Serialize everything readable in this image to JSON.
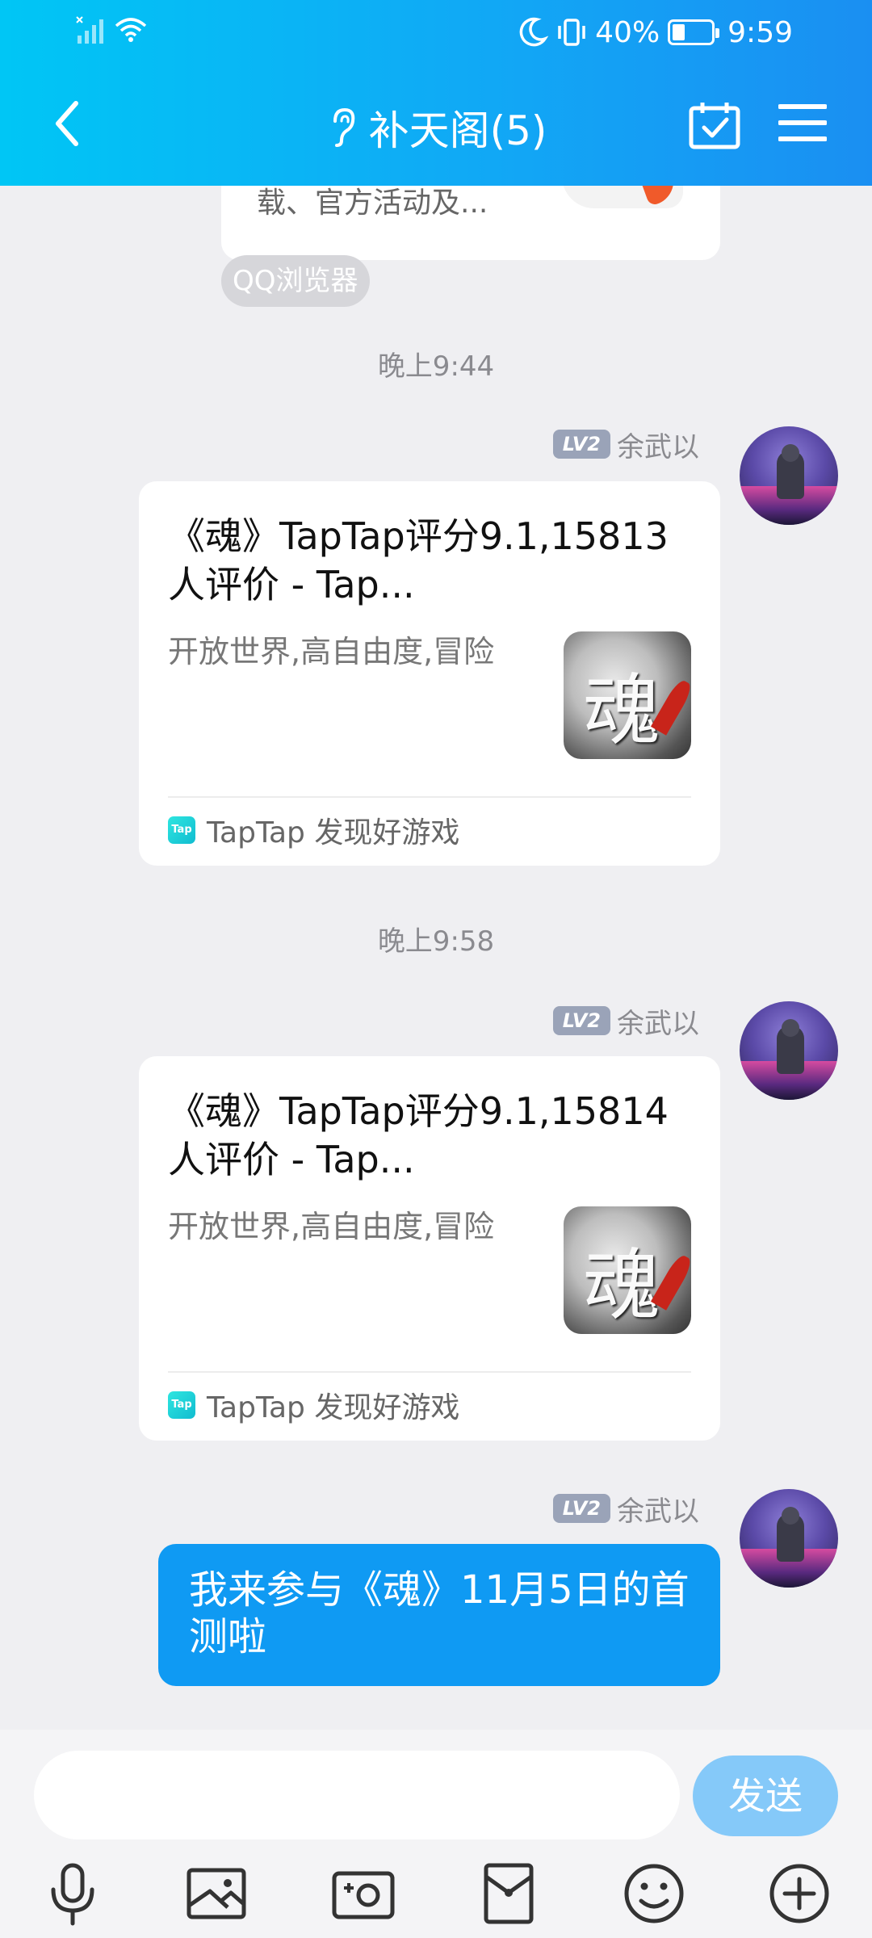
{
  "status_bar": {
    "battery": "40%",
    "battery_level": 0.4,
    "time": "9:59"
  },
  "header": {
    "title": "补天阁(5)",
    "icons": [
      "back-icon",
      "ear-icon",
      "calendar-check-icon",
      "menu-icon"
    ]
  },
  "previous_message": {
    "snippet": "载、官方活动及...",
    "source_tag": "QQ浏览器"
  },
  "messages": [
    {
      "time": "晚上9:44",
      "level": "LV2",
      "sender": "余武以",
      "card": {
        "title": "《魂》TapTap评分9.1,15813 人评价 - Tap...",
        "desc": "开放世界,高自由度,冒险",
        "source": "TapTap 发现好游戏",
        "source_icon": "Tap"
      }
    },
    {
      "time": "晚上9:58",
      "level": "LV2",
      "sender": "余武以",
      "card": {
        "title": "《魂》TapTap评分9.1,15814 人评价 - Tap...",
        "desc": "开放世界,高自由度,冒险",
        "source": "TapTap 发现好游戏",
        "source_icon": "Tap"
      }
    },
    {
      "level": "LV2",
      "sender": "余武以",
      "text": "我来参与《魂》11月5日的首测啦"
    }
  ],
  "input": {
    "value": "",
    "send_label": "发送"
  },
  "toolbar": [
    "microphone-icon",
    "image-icon",
    "camera-icon",
    "red-packet-icon",
    "emoji-icon",
    "plus-icon"
  ],
  "colors": {
    "header_gradient_start": "#00c6f5",
    "header_gradient_end": "#1a8ff2",
    "bubble": "#0f9af3",
    "send_button": "#85c9f9",
    "background": "#efeff2"
  }
}
